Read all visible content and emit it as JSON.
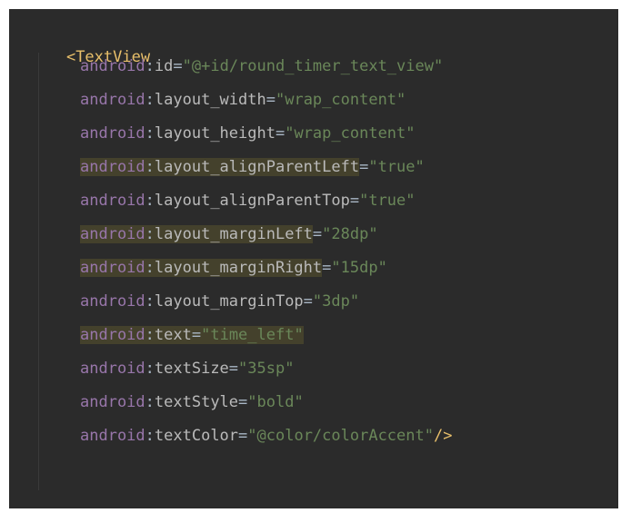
{
  "code": {
    "open_tag": "<TextView",
    "close_tag": "/>",
    "namespace": "android",
    "lines": [
      {
        "attr": "id",
        "value": "\"@+id/round_timer_text_view\""
      },
      {
        "attr": "layout_width",
        "value": "\"wrap_content\""
      },
      {
        "attr": "layout_height",
        "value": "\"wrap_content\""
      },
      {
        "attr": "layout_alignParentLeft",
        "value": "\"true\""
      },
      {
        "attr": "layout_alignParentTop",
        "value": "\"true\""
      },
      {
        "attr": "layout_marginLeft",
        "value": "\"28dp\""
      },
      {
        "attr": "layout_marginRight",
        "value": "\"15dp\""
      },
      {
        "attr": "layout_marginTop",
        "value": "\"3dp\""
      },
      {
        "attr": "text",
        "value": "\"time_left\""
      },
      {
        "attr": "textSize",
        "value": "\"35sp\""
      },
      {
        "attr": "textStyle",
        "value": "\"bold\""
      },
      {
        "attr": "textColor",
        "value": "\"@color/colorAccent\""
      }
    ]
  }
}
